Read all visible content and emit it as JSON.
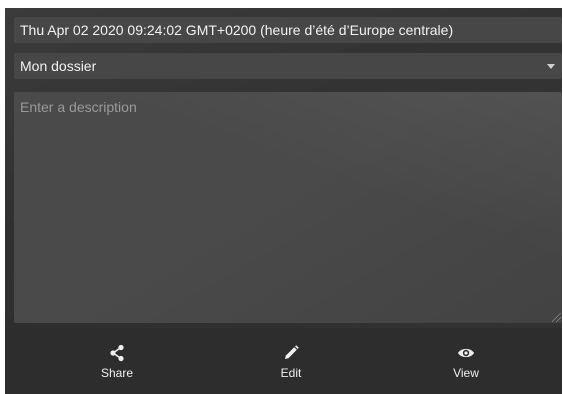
{
  "header": {
    "title": "Thu Apr 02 2020 09:24:02 GMT+0200 (heure d’été d’Europe centrale)"
  },
  "folder": {
    "selected": "Mon dossier"
  },
  "description": {
    "placeholder": "Enter a description",
    "value": ""
  },
  "toolbar": {
    "share_label": "Share",
    "share_icon": "share-icon",
    "edit_label": "Edit",
    "edit_icon": "pencil-icon",
    "view_label": "View",
    "view_icon": "eye-icon"
  },
  "colors": {
    "panel_bg": "#333333",
    "field_bg": "#474747",
    "toolbar_bg": "#2d2d2d",
    "text": "#f2f2f2",
    "placeholder": "#9a9a9a"
  }
}
